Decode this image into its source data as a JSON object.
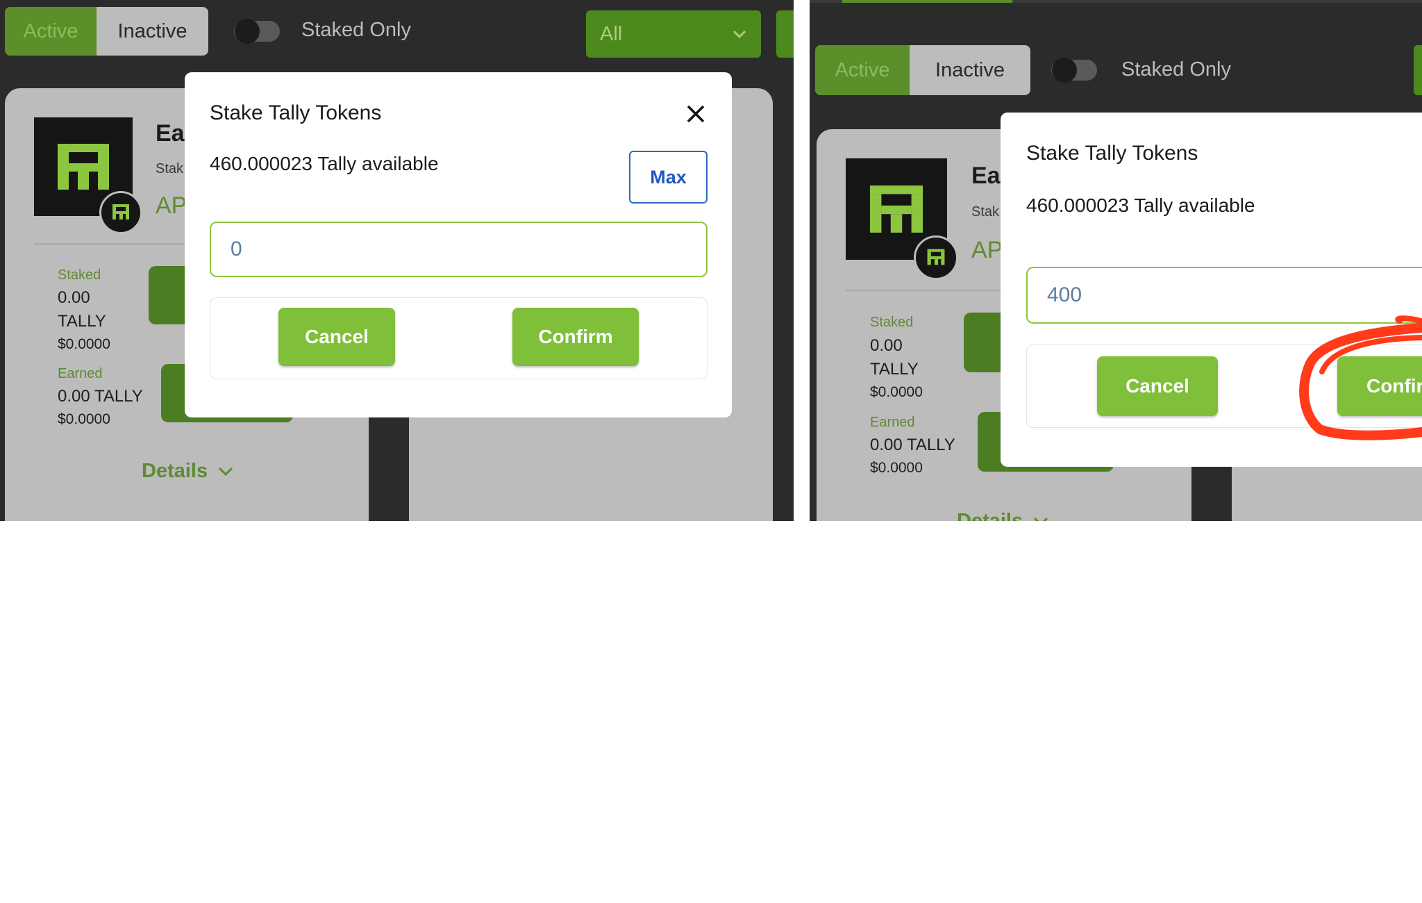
{
  "colors": {
    "accent_green": "#7fbf3a",
    "annotation_red": "#ff3b1a",
    "max_blue": "#2357c3"
  },
  "left": {
    "filters": {
      "active": "Active",
      "inactive": "Inactive",
      "staked_only": "Staked Only",
      "select_value": "All"
    },
    "card": {
      "title_partial": "Ear",
      "subtitle_partial": "Stak",
      "apr_partial": "AP",
      "staked_label": "Staked",
      "staked_value": "0.00",
      "staked_unit": "TALLY",
      "staked_usd": "$0.0000",
      "earned_label": "Earned",
      "earned_value": "0.00 TALLY",
      "earned_usd": "$0.0000",
      "details": "Details"
    },
    "modal": {
      "title": "Stake Tally Tokens",
      "available": "460.000023 Tally available",
      "max_label": "Max",
      "amount": "0",
      "cancel": "Cancel",
      "confirm": "Confirm"
    }
  },
  "right": {
    "filters": {
      "active": "Active",
      "inactive": "Inactive",
      "staked_only": "Staked Only"
    },
    "card": {
      "title_partial": "Ear",
      "subtitle_partial": "Stak",
      "apr_partial": "AP",
      "staked_label": "Staked",
      "staked_value": "0.00",
      "staked_unit": "TALLY",
      "staked_usd": "$0.0000",
      "earned_label": "Earned",
      "earned_value": "0.00 TALLY",
      "earned_usd": "$0.0000",
      "details": "Details"
    },
    "modal": {
      "title": "Stake Tally Tokens",
      "available": "460.000023 Tally available",
      "amount": "400",
      "cancel": "Cancel",
      "confirm": "Confir"
    }
  }
}
